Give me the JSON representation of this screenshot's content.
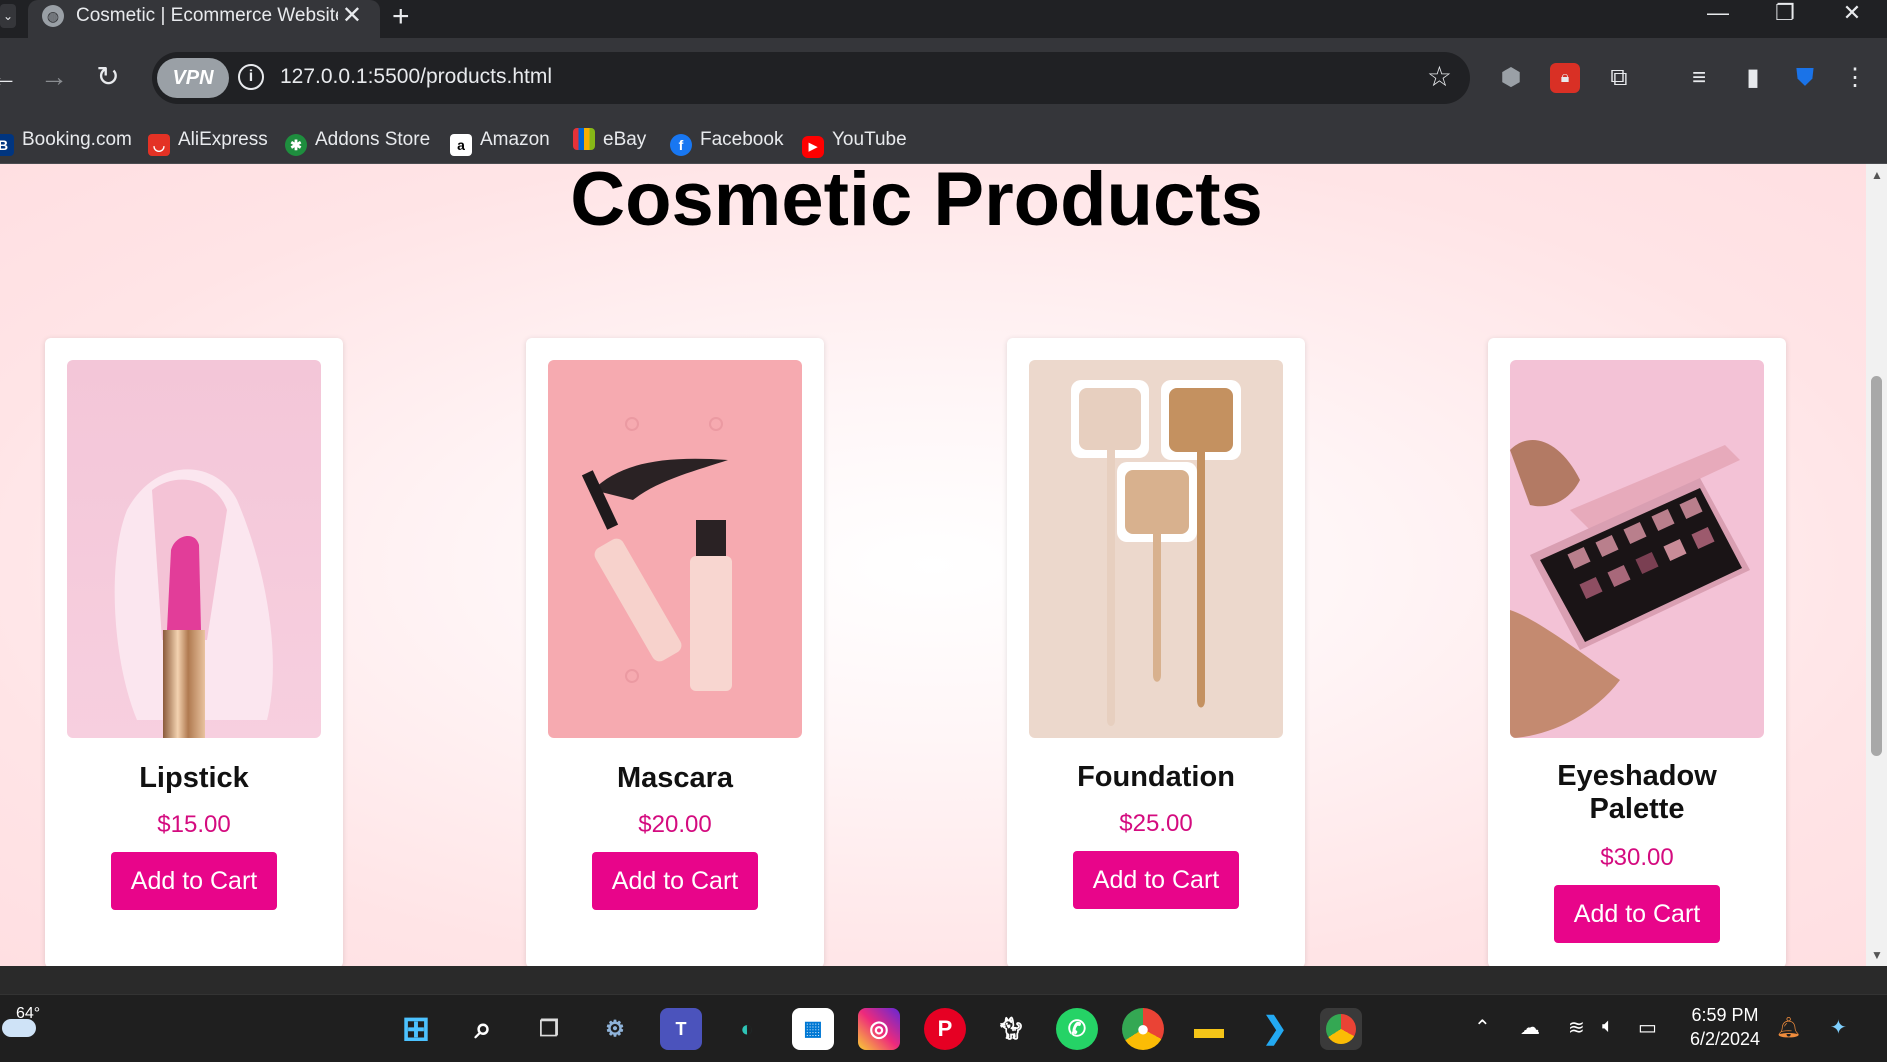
{
  "browser": {
    "tab_title": "Cosmetic | Ecommerce Website",
    "url": "127.0.0.1:5500/products.html",
    "vpn_label": "VPN",
    "bookmarks": [
      "Booking.com",
      "AliExpress",
      "Addons Store",
      "Amazon",
      "eBay",
      "Facebook",
      "YouTube"
    ]
  },
  "page": {
    "title": "Cosmetic Products",
    "products": [
      {
        "name": "Lipstick",
        "price": "$15.00",
        "button": "Add to Cart"
      },
      {
        "name": "Mascara",
        "price": "$20.00",
        "button": "Add to Cart"
      },
      {
        "name": "Foundation",
        "price": "$25.00",
        "button": "Add to Cart"
      },
      {
        "name": "Eyeshadow Palette",
        "price": "$30.00",
        "button": "Add to Cart"
      }
    ]
  },
  "taskbar": {
    "temperature": "64°",
    "time": "6:59 PM",
    "date": "6/2/2024"
  },
  "colors": {
    "accent": "#e8058a",
    "price": "#d40b7f"
  }
}
